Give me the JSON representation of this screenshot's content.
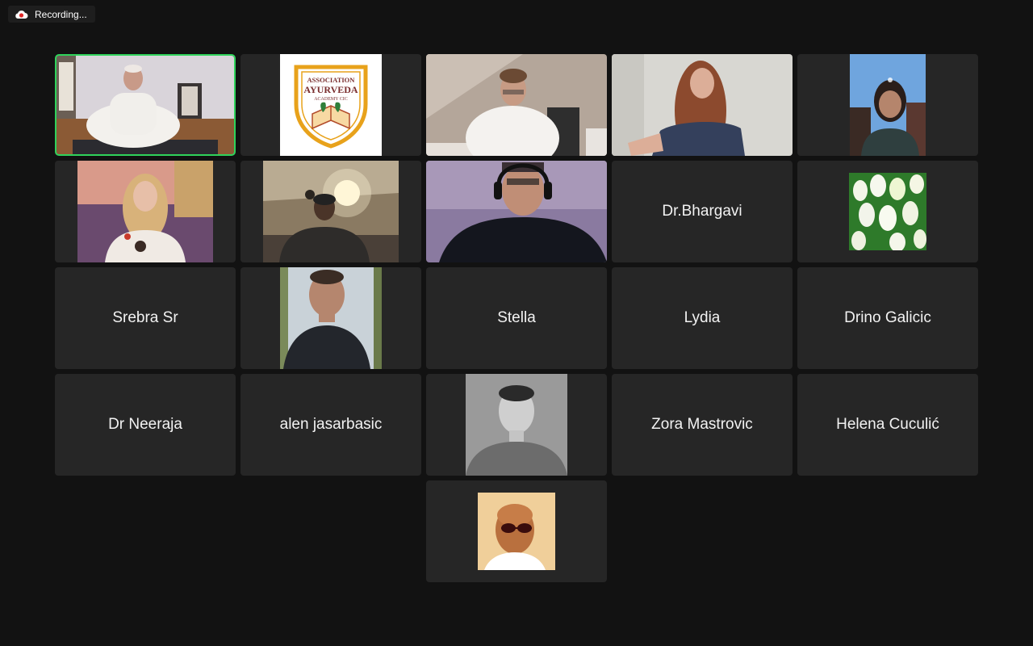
{
  "recording": {
    "label": "Recording...",
    "icon": "cloud-recording-icon",
    "icon_color": "#e02828"
  },
  "accent_colors": {
    "active_speaker": "#2fd35b",
    "tile_bg": "#262626",
    "page_bg": "#121212"
  },
  "participants": [
    {
      "kind": "video",
      "desc": "man-white-sweater-yoga-room",
      "active": true
    },
    {
      "kind": "image",
      "desc": "ayurveda-logo",
      "logo_text": [
        "ASSOCIATION",
        "AYURVEDA",
        "ACADEMY CIC"
      ]
    },
    {
      "kind": "video",
      "desc": "young-man-glasses-white-shirt"
    },
    {
      "kind": "video",
      "desc": "woman-long-red-hair"
    },
    {
      "kind": "video",
      "desc": "woman-dark-hair-chair"
    },
    {
      "kind": "video",
      "desc": "young-woman-blonde-hair"
    },
    {
      "kind": "video",
      "desc": "man-cap-lamp-room"
    },
    {
      "kind": "video",
      "desc": "man-headphones-purple-light"
    },
    {
      "kind": "name",
      "name": "Dr.Bhargavi"
    },
    {
      "kind": "image",
      "desc": "white-tulips"
    },
    {
      "kind": "name",
      "name": "Srebra Sr"
    },
    {
      "kind": "image",
      "desc": "man-short-hair-portrait"
    },
    {
      "kind": "name",
      "name": "Stella"
    },
    {
      "kind": "name",
      "name": "Lydia"
    },
    {
      "kind": "name",
      "name": "Drino Galicic"
    },
    {
      "kind": "name",
      "name": "Dr Neeraja"
    },
    {
      "kind": "name",
      "name": "alen jasarbasic"
    },
    {
      "kind": "image",
      "desc": "man-black-white-portrait"
    },
    {
      "kind": "name",
      "name": "Zora Mastrovic"
    },
    {
      "kind": "name",
      "name": "Helena Cuculić"
    },
    {
      "kind": "image",
      "desc": "bald-man-red-sunglasses"
    }
  ]
}
